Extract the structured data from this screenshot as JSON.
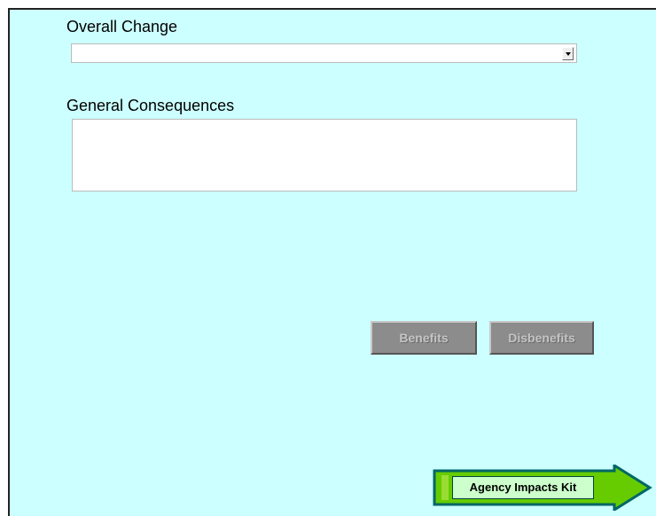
{
  "form": {
    "overall_change_label": "Overall Change",
    "overall_change_value": "",
    "general_consequences_label": "General Consequences",
    "general_consequences_value": ""
  },
  "buttons": {
    "benefits_label": "Benefits",
    "disbenefits_label": "Disbenefits",
    "benefits_enabled": false,
    "disbenefits_enabled": false
  },
  "navigation": {
    "agency_kit_label": "Agency Impacts Kit"
  },
  "colors": {
    "background": "#ccffff",
    "button_disabled": "#8c8c8c",
    "arrow_fill": "#66cc00",
    "arrow_border": "#006666",
    "kit_label_bg": "#ccffcc"
  },
  "icons": {
    "dropdown": "chevron-down-icon",
    "nav_arrow": "arrow-right-icon"
  }
}
